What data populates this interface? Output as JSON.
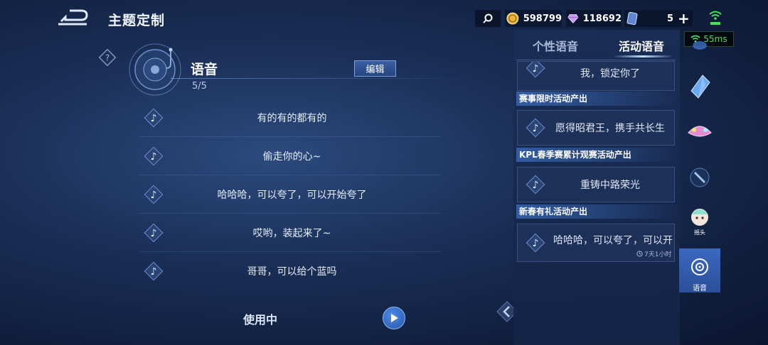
{
  "header": {
    "title": "主题定制"
  },
  "currency": {
    "gold": "598799",
    "diamond": "118692",
    "cards": "5",
    "ping": "55ms",
    "colors": {
      "gold": "#e8b53c",
      "diamond": "#c79cf0",
      "card": "#7fa7e8",
      "ping": "#46e05a"
    }
  },
  "voice": {
    "title": "语音",
    "count": "5/5",
    "edit_label": "编辑",
    "items": [
      "有的有的都有的",
      "偷走你的心~",
      "哈哈哈，可以夸了，可以开始夸了",
      "哎哟，装起来了~",
      "哥哥，可以给个蓝吗"
    ],
    "status": "使用中"
  },
  "panel": {
    "tabs": [
      "个性语音",
      "活动语音"
    ],
    "active_tab": "活动语音",
    "top_partial": "我，锁定你了",
    "sections": [
      {
        "heading": "赛事限时活动产出",
        "text": "愿得昭君王，携手共长生"
      },
      {
        "heading": "KPL春季赛累计观赛活动产出",
        "text": "重铸中路荣光"
      },
      {
        "heading": "新春有礼活动产出",
        "text": "哈哈哈，可以夸了，可以开",
        "timer": "7天1小时"
      }
    ]
  },
  "side_tabs": {
    "mini_label": "摇头",
    "active_label": "语音",
    "icons": [
      "wing-icon",
      "crystal-icon",
      "fan-icon",
      "sword-icon",
      "avatar-icon",
      "voice-disc-icon"
    ]
  }
}
